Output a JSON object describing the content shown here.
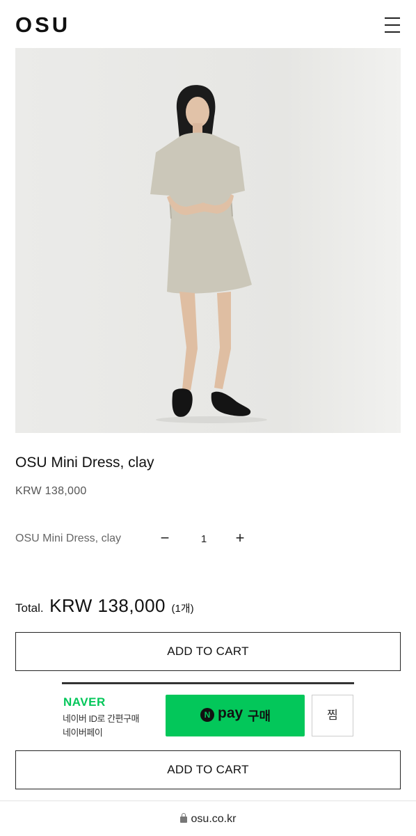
{
  "header": {
    "logo": "OSU",
    "menu_icon": "hamburger-menu-icon"
  },
  "product": {
    "image_icon": "product-photo",
    "title": "OSU Mini Dress, clay",
    "price": "KRW 138,000"
  },
  "option": {
    "name": "OSU Mini Dress, clay",
    "minus": "−",
    "quantity": "1",
    "plus": "+"
  },
  "total": {
    "label": "Total.",
    "amount": "KRW 138,000",
    "count": "(1개)"
  },
  "buttons": {
    "add_to_cart": "ADD TO CART",
    "add_to_cart_2": "ADD TO CART"
  },
  "naver": {
    "brand": "NAVER",
    "line1": "네이버 ID로 간편구매",
    "line2": "네이버페이",
    "npay_n": "N",
    "npay_pay": "pay",
    "npay_buy": "구매",
    "jjim": "찜",
    "brand_color": "#03c75a"
  },
  "browser": {
    "url": "osu.co.kr"
  }
}
